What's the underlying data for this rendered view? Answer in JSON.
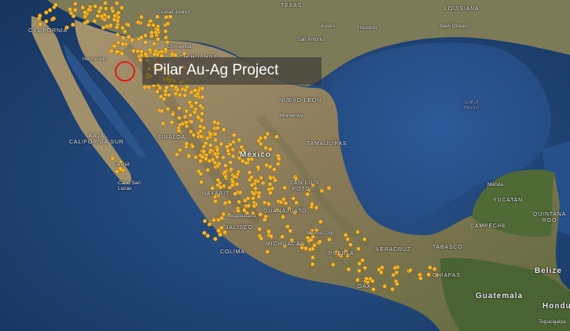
{
  "project": {
    "label": "Pilar Au-Ag Project",
    "marker_color": "#e01b1b"
  },
  "occurrence_color": "#f2b630",
  "labels": {
    "texas": "TEXAS",
    "louisiana": "LOUISIANA",
    "california": "CALIFORNIA",
    "chihuahua_state": "CHIHUAHUA",
    "nuevo_leon": "NUEVO LEON",
    "baja_sur": "BAJA\nCALIFORNIA SUR",
    "sinaloa": "SINALOA",
    "tamaulipas": "TAMAULIPAS",
    "mexico": "México",
    "san_luis": "SAN LUIS\nPOTOSÍ",
    "nayarit": "NAYARIT",
    "guanajuato": "GUANAJUATO",
    "jalisco": "JALISCO",
    "colima": "COLIMA",
    "michoacan": "MICHOACÁN",
    "puebla": "PUEBLA",
    "veracruz": "VERACRUZ",
    "tabasco": "TABASCO",
    "campeche": "CAMPECHE",
    "yucatan": "YUCATAN",
    "quintana_roo": "QUINTANA\nROO",
    "chiapas": "CHIAPAS",
    "oaxaca": "OAX",
    "guatemala": "Guatemala",
    "belize": "Belize",
    "honduras": "Hondu",
    "austin": "Austin",
    "san_antonio": "San Antonio",
    "houston": "Houston",
    "new_orleans": "New Orleans",
    "ciudad_juarez": "Ciudad Juárez",
    "hermosillo": "Hermosillo",
    "chihuahua_city": "Chihuahua",
    "monterrey": "Monterrey",
    "la_paz": "La Paz",
    "cabo": "Cabo San\nLucas",
    "guadalajara": "Guadalajara",
    "mexico_city": "Mexico City",
    "merida": "Mérida",
    "gulf": "Gulf of\nMexico",
    "tegucigalpa": "Tegucigalpa"
  }
}
